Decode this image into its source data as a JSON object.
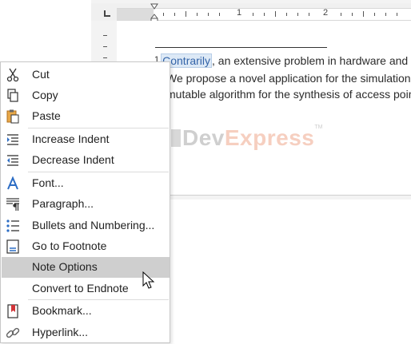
{
  "ruler": {
    "numbers": [
      "1",
      "2"
    ]
  },
  "document": {
    "footnote_number": "1",
    "line1_selected": "Contrarily",
    "line1_rest": ", an extensive problem in hardware and arc",
    "line2": "We propose a novel application for the simulation",
    "line3": "mutable algorithm for the synthesis of access point",
    "logo_dev": "Dev",
    "logo_express": "Express",
    "logo_tm": "TM"
  },
  "menu": {
    "items": [
      {
        "label": "Cut",
        "icon": "scissors-icon"
      },
      {
        "label": "Copy",
        "icon": "copy-icon"
      },
      {
        "label": "Paste",
        "icon": "paste-icon"
      },
      {
        "label": "Increase Indent",
        "icon": "increase-indent-icon"
      },
      {
        "label": "Decrease Indent",
        "icon": "decrease-indent-icon"
      },
      {
        "label": "Font...",
        "icon": "font-icon"
      },
      {
        "label": "Paragraph...",
        "icon": "paragraph-icon"
      },
      {
        "label": "Bullets and Numbering...",
        "icon": "bullets-icon"
      },
      {
        "label": "Go to Footnote",
        "icon": "footnote-icon"
      },
      {
        "label": "Note Options",
        "icon": "",
        "highlighted": true
      },
      {
        "label": "Convert to Endnote",
        "icon": ""
      },
      {
        "label": "Bookmark...",
        "icon": "bookmark-icon"
      },
      {
        "label": "Hyperlink...",
        "icon": "hyperlink-icon"
      }
    ]
  },
  "colors": {
    "highlight": "#cfcfcf",
    "accent_blue": "#2b6cc4",
    "logo_orange": "#f6cfc0"
  }
}
